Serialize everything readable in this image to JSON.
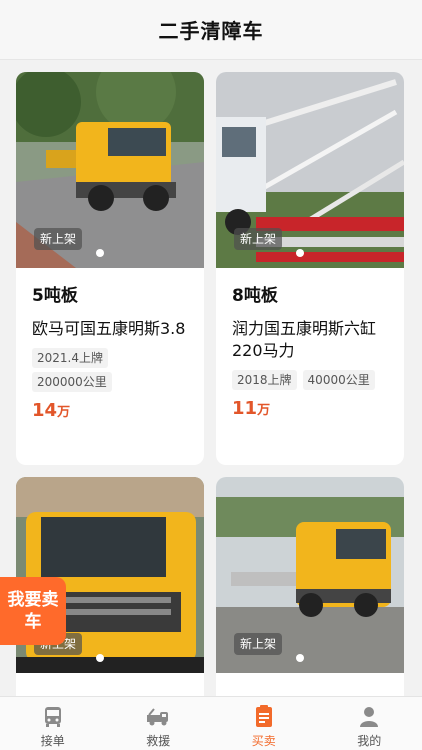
{
  "header": {
    "title": "二手清障车"
  },
  "listings": [
    {
      "badge": "新上架",
      "spec": "5吨板",
      "name": "欧马可国五康明斯3.8",
      "tags": [
        "2021.4上牌",
        "200000公里"
      ],
      "price": "14",
      "unit": "万"
    },
    {
      "badge": "新上架",
      "spec": "8吨板",
      "name": "润力国五康明斯六缸220马力",
      "tags": [
        "2018上牌",
        "40000公里"
      ],
      "price": "11",
      "unit": "万"
    },
    {
      "badge": "新上架"
    },
    {
      "badge": "新上架"
    }
  ],
  "sell_button": "我要卖车",
  "tabbar": {
    "items": [
      {
        "label": "接单",
        "icon": "bus-icon"
      },
      {
        "label": "救援",
        "icon": "tow-truck-icon"
      },
      {
        "label": "买卖",
        "icon": "document-icon"
      },
      {
        "label": "我的",
        "icon": "user-icon"
      }
    ]
  },
  "colors": {
    "accent": "#f26a2a",
    "price": "#e2562a",
    "sell_button": "#ff6a2b",
    "truck_yellow": "#f2b51c"
  }
}
